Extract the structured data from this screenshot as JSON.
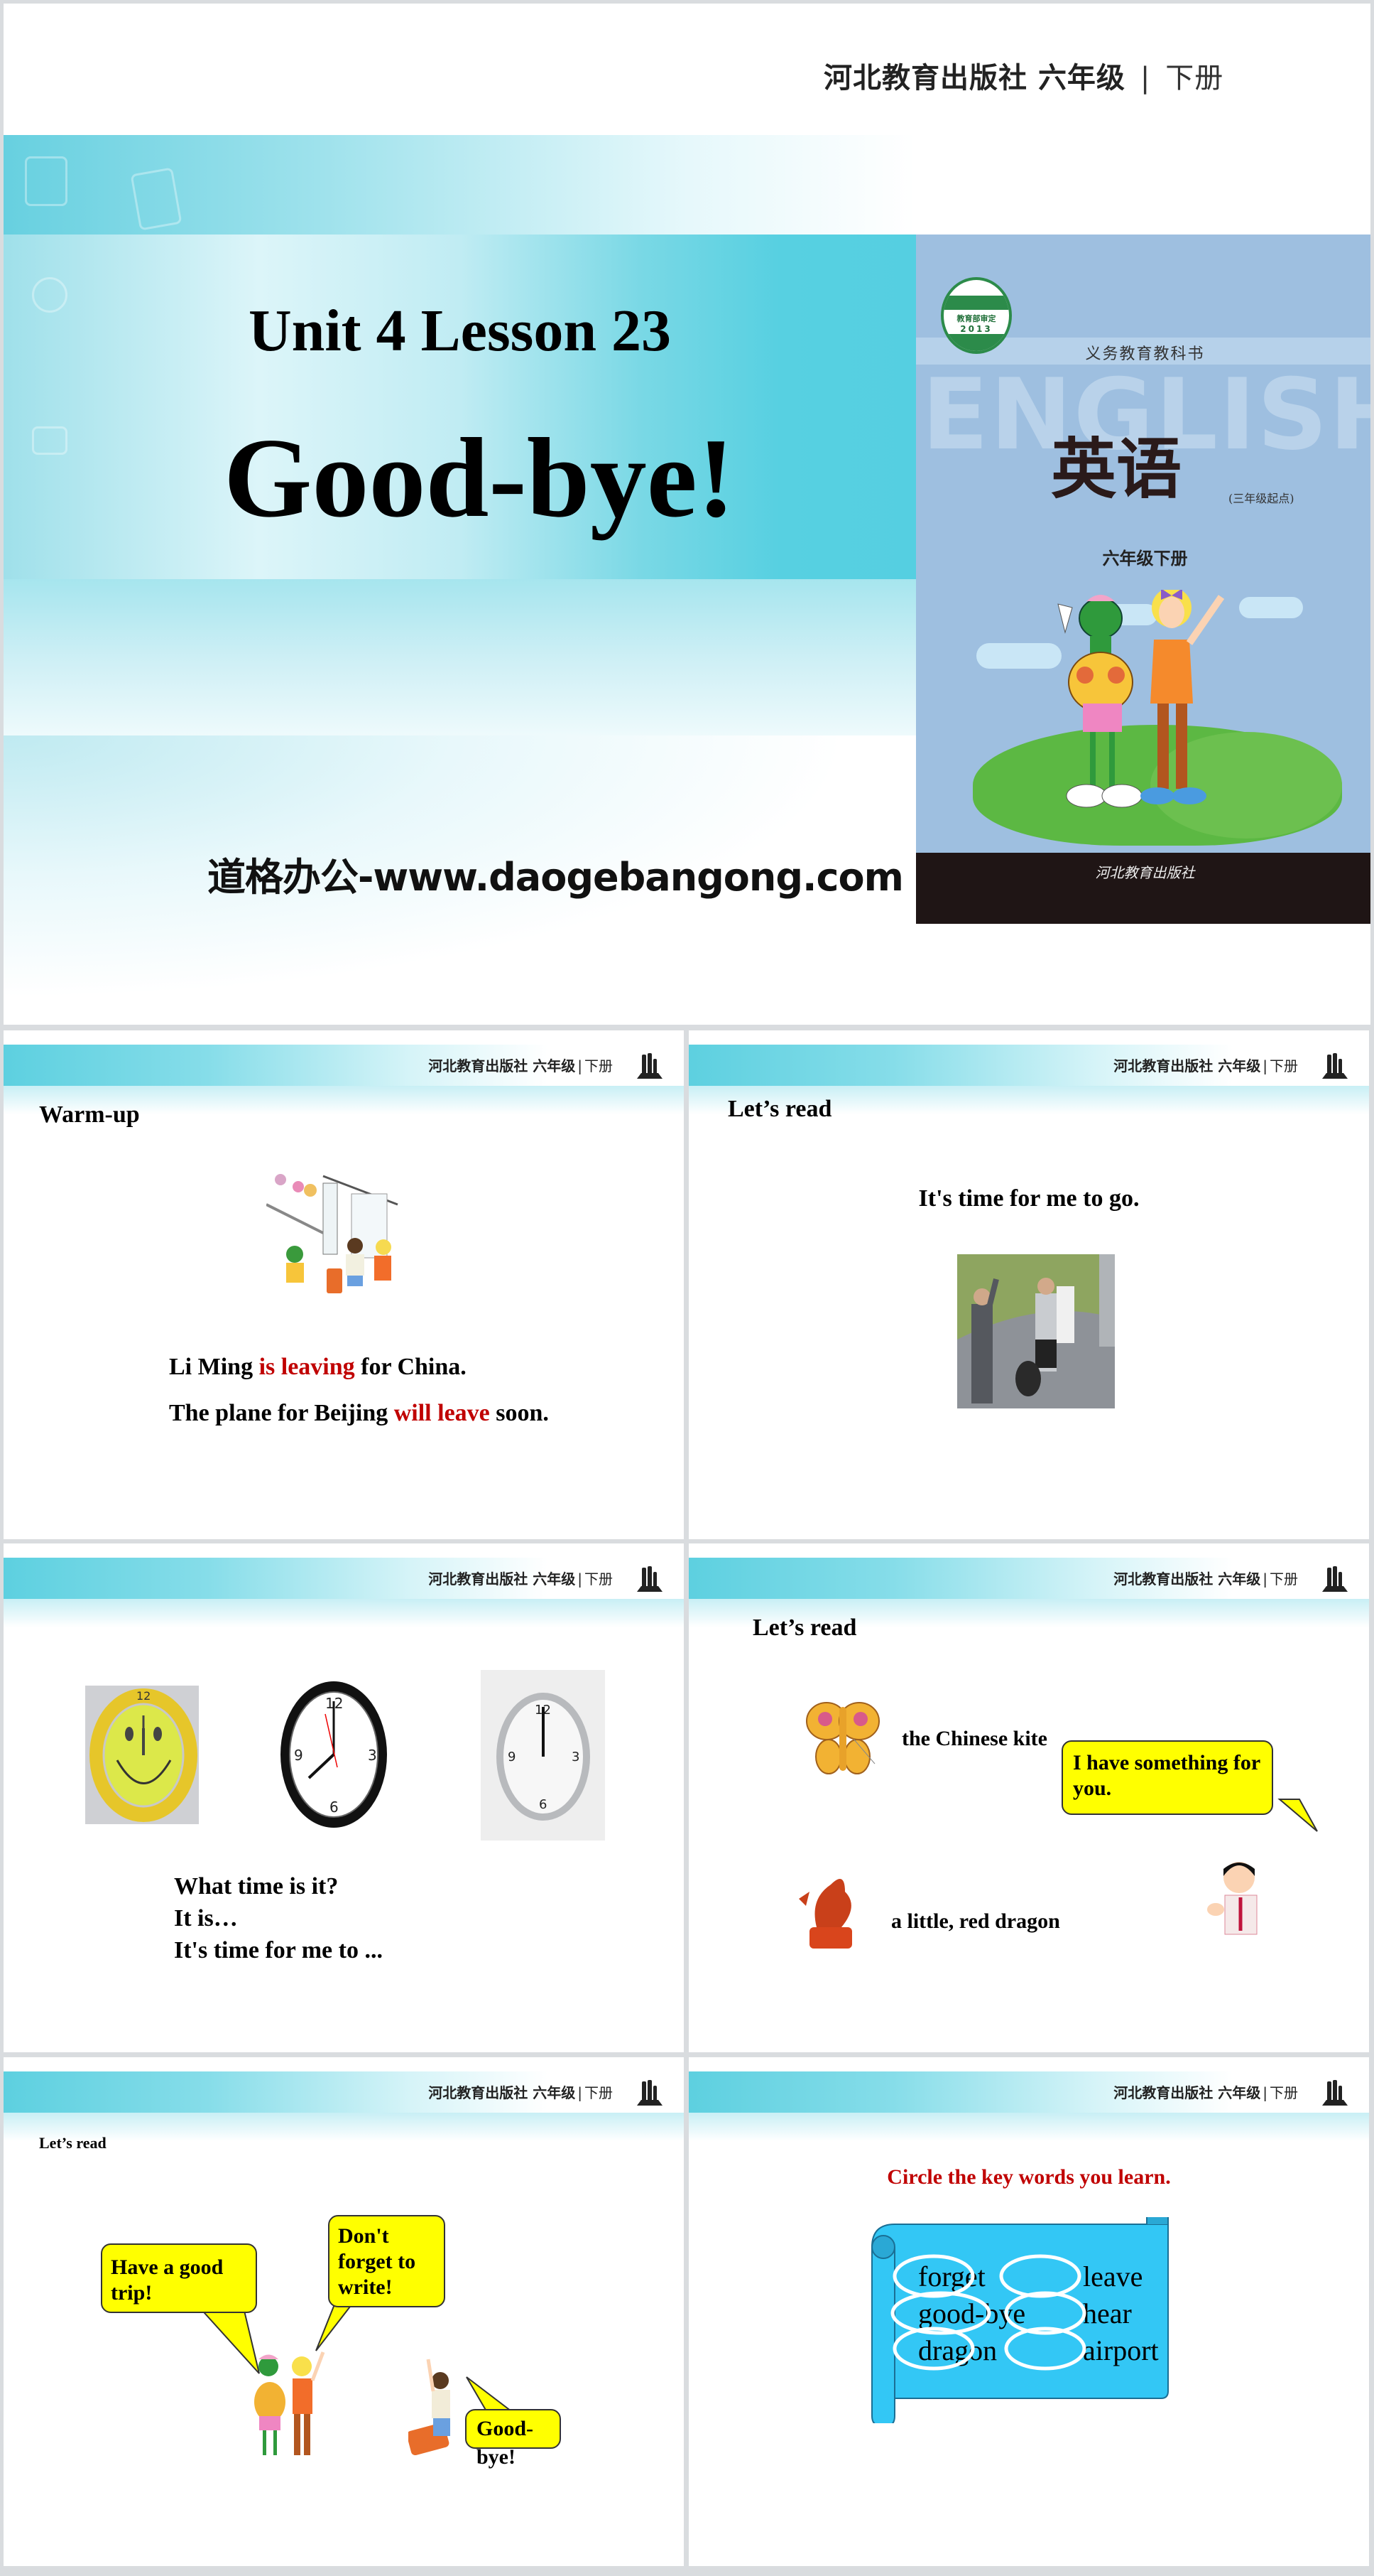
{
  "publisher_header": {
    "publisher": "河北教育出版社",
    "grade": "六年级",
    "separator": "|",
    "volume": "下册"
  },
  "title_slide": {
    "lesson": "Unit 4 Lesson 23",
    "title": "Good-bye!",
    "watermark": "道格办公-www.daogebangong.com",
    "cover": {
      "seal_text": "教育部审定",
      "seal_year": "2013",
      "series": "义务教育教科书",
      "english": "ENGLISH",
      "subject": "英语",
      "start_level": "(三年级起点)",
      "grade_volume": "六年级下册",
      "publisher": "河北教育出版社"
    }
  },
  "slides": [
    {
      "section": "Warm-up",
      "lines": [
        {
          "parts": [
            {
              "text": "Li Ming ",
              "highlight": false
            },
            {
              "text": "is leaving",
              "highlight": true
            },
            {
              "text": " for China.",
              "highlight": false
            }
          ]
        },
        {
          "parts": [
            {
              "text": "The plane for Beijing ",
              "highlight": false
            },
            {
              "text": "will leave",
              "highlight": true
            },
            {
              "text": " soon.",
              "highlight": false
            }
          ]
        }
      ],
      "image": "airport-farewell-illustration"
    },
    {
      "section": "Let’s read",
      "sentence": "It's time for me to go.",
      "image": "people-waving-goodbye-photo"
    },
    {
      "clocks": [
        {
          "name": "smiley-clock",
          "time": "12:00"
        },
        {
          "name": "black-wall-clock",
          "time": "8:00"
        },
        {
          "name": "silver-wall-clock",
          "time": "12:00"
        }
      ],
      "lines": [
        "What time is it?",
        "It is…",
        "It's time for me to ..."
      ]
    },
    {
      "section": "Let’s read",
      "item1": "the Chinese kite",
      "item2": "a little, red dragon",
      "bubble": "I have something for you."
    },
    {
      "section": "Let’s read",
      "bubbles": [
        "Have a good trip!",
        "Don't forget to write!",
        "Good-bye!"
      ]
    },
    {
      "instruction": "Circle the key words you learn.",
      "words_left": [
        "forget",
        "good-bye",
        "dragon"
      ],
      "words_right": [
        "leave",
        "hear",
        "airport"
      ]
    }
  ],
  "colors": {
    "accent_cyan": "#55cfe1",
    "highlight_red": "#c00000",
    "bubble_yellow": "#ffff00",
    "scroll_blue": "#33c7f5"
  }
}
